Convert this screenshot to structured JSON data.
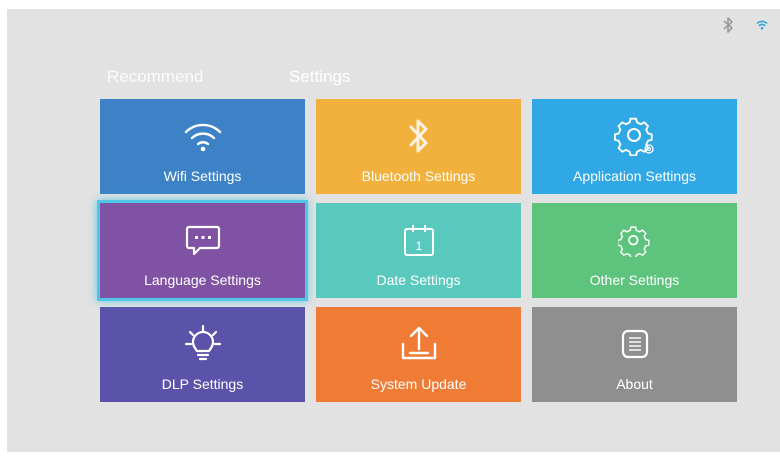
{
  "status_bar": {
    "icons": [
      "bluetooth-icon",
      "wifi-icon"
    ],
    "accent": "#37a6d9"
  },
  "tabs": [
    {
      "label": "Recommend",
      "selected": false
    },
    {
      "label": "Settings",
      "selected": true
    }
  ],
  "tiles": [
    {
      "label": "Wifi Settings",
      "icon": "wifi-icon",
      "color": "#3d82c6"
    },
    {
      "label": "Bluetooth Settings",
      "icon": "bluetooth-icon",
      "color": "#f1b13c"
    },
    {
      "label": "Application Settings",
      "icon": "gear-icon",
      "color": "#2fa8e5"
    },
    {
      "label": "Language Settings",
      "icon": "chat-bubble-icon",
      "color": "#7f52a3",
      "focused": true
    },
    {
      "label": "Date Settings",
      "icon": "calendar-icon",
      "color": "#59c9bd"
    },
    {
      "label": "Other Settings",
      "icon": "gear-icon",
      "color": "#5ec47d"
    },
    {
      "label": "DLP Settings",
      "icon": "lightbulb-icon",
      "color": "#5b53aa"
    },
    {
      "label": "System Update",
      "icon": "upload-icon",
      "color": "#f07b35"
    },
    {
      "label": "About",
      "icon": "document-icon",
      "color": "#8f8f8f"
    }
  ]
}
